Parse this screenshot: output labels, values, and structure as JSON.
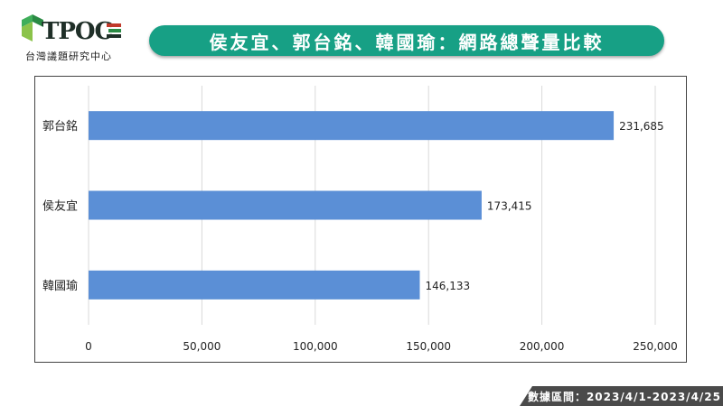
{
  "logo": {
    "name": "TPOC",
    "subtitle": "台灣議題研究中心"
  },
  "title": "侯友宜、郭台銘、韓國瑜：網路總聲量比較",
  "footer": {
    "date_range": "數據區間：2023/4/1-2023/4/25"
  },
  "colors": {
    "banner": "#17a085",
    "bar": "#5b8fd6"
  },
  "chart_data": {
    "type": "bar",
    "orientation": "horizontal",
    "categories": [
      "郭台銘",
      "侯友宜",
      "韓國瑜"
    ],
    "values": [
      231685,
      173415,
      146133
    ],
    "value_labels": [
      "231,685",
      "173,415",
      "146,133"
    ],
    "xlim": [
      0,
      250000
    ],
    "xticks": [
      0,
      50000,
      100000,
      150000,
      200000,
      250000
    ],
    "xtick_labels": [
      "0",
      "50,000",
      "100,000",
      "150,000",
      "200,000",
      "250,000"
    ],
    "grid": "vertical",
    "legend": "none"
  }
}
